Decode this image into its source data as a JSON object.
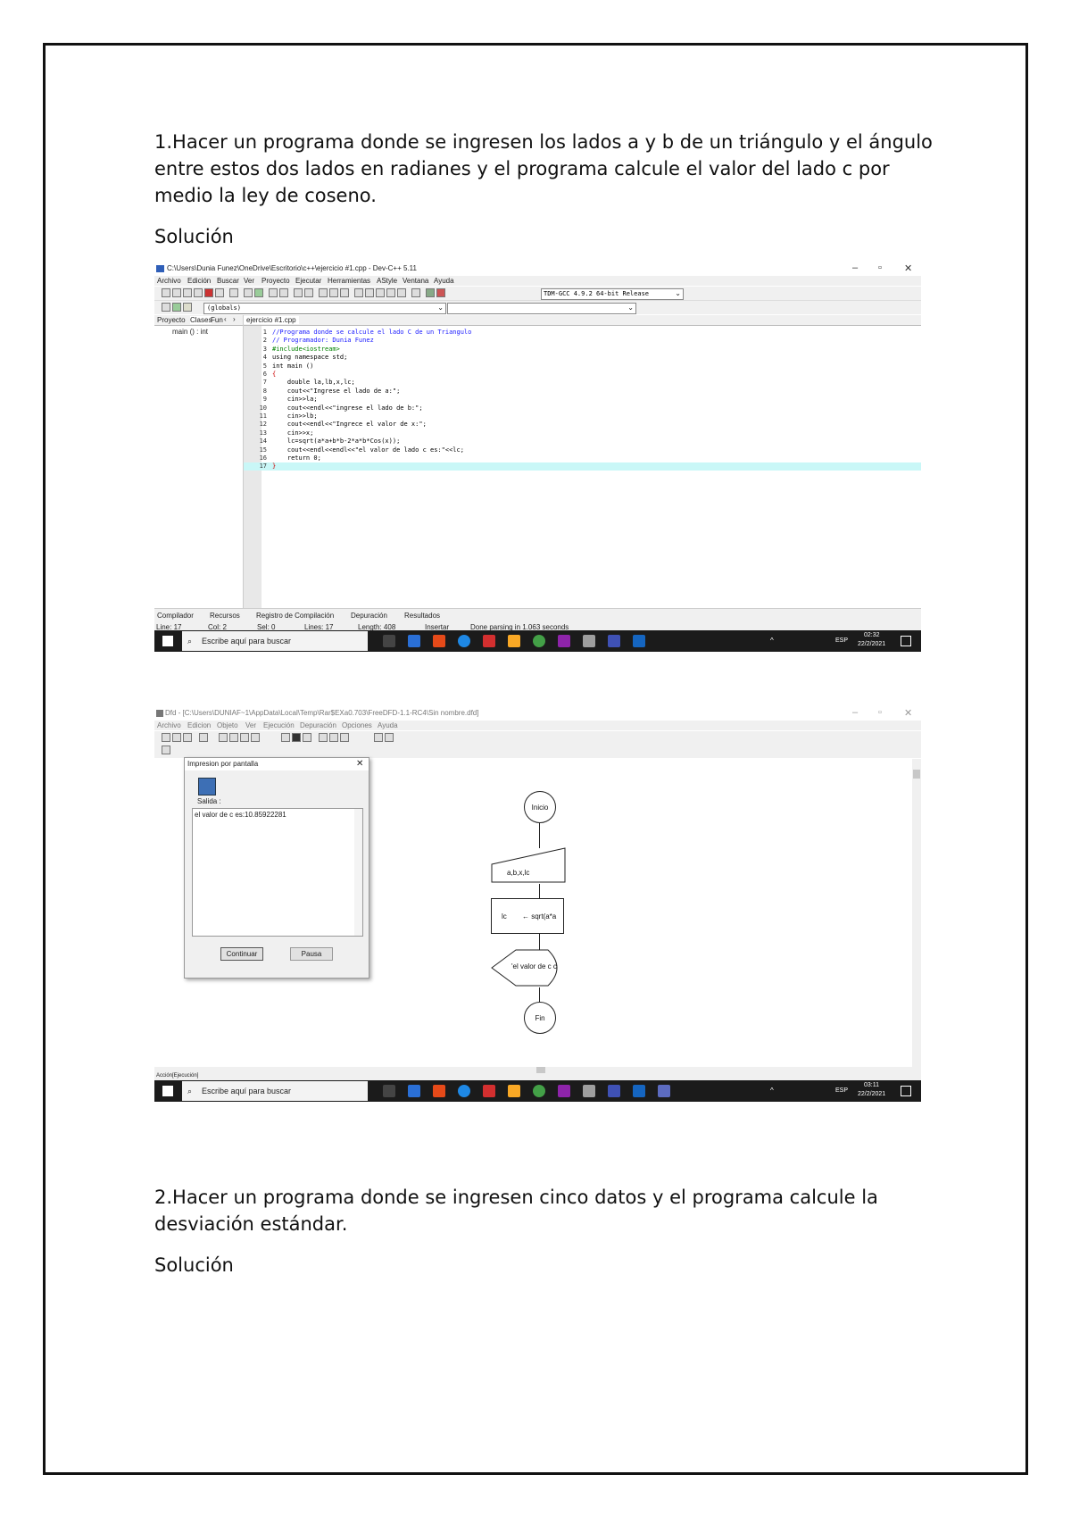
{
  "document": {
    "q1_text": "1.Hacer un programa donde se ingresen los lados a y b de un triángulo y el ángulo entre estos dos lados en radianes y el programa calcule el valor del lado c por medio la ley de coseno.",
    "solucion_label": "Solución",
    "q2_text": " 2.Hacer un programa donde se ingresen cinco datos y el programa calcule la desviación estándar.",
    "solucion2_label": "Solución"
  },
  "devcpp": {
    "title": "C:\\Users\\Dunia Funez\\OneDrive\\Escritorio\\c++\\ejercicio #1.cpp - Dev-C++ 5.11",
    "menu": [
      "Archivo",
      "Edición",
      "Buscar",
      "Ver",
      "Proyecto",
      "Ejecutar",
      "Herramientas",
      "AStyle",
      "Ventana",
      "Ayuda"
    ],
    "compiler_select": "TDM-GCC 4.9.2 64-bit Release",
    "scope_select": "(globals)",
    "left_tabs": [
      "Proyecto",
      "Clases",
      "Fun"
    ],
    "tree_item": "main () : int",
    "file_tab": "ejercicio #1.cpp",
    "code": [
      {
        "n": "1",
        "text": "//Programa donde se calcule el lado C de un Triangulo",
        "color": "#1a1aff"
      },
      {
        "n": "2",
        "text": "// Programador: Dunia Funez",
        "color": "#1a1aff"
      },
      {
        "n": "3",
        "text": "#include<iostream>",
        "color": "#008000"
      },
      {
        "n": "4",
        "text": "using namespace std;",
        "color": "#000000"
      },
      {
        "n": "5",
        "text": "int main ()",
        "color": "#000000"
      },
      {
        "n": "6",
        "text": "{",
        "color": "#cc0000"
      },
      {
        "n": "7",
        "text": "    double la,lb,x,lc;",
        "color": "#000000"
      },
      {
        "n": "8",
        "text": "    cout<<\"Ingrese el lado de a:\";",
        "color": "#000000"
      },
      {
        "n": "9",
        "text": "    cin>>la;",
        "color": "#000000"
      },
      {
        "n": "10",
        "text": "    cout<<endl<<\"ingrese el lado de b:\";",
        "color": "#000000"
      },
      {
        "n": "11",
        "text": "    cin>>lb;",
        "color": "#000000"
      },
      {
        "n": "12",
        "text": "    cout<<endl<<\"Ingrece el valor de x:\";",
        "color": "#000000"
      },
      {
        "n": "13",
        "text": "    cin>>x;",
        "color": "#000000"
      },
      {
        "n": "14",
        "text": "    lc=sqrt(a*a+b*b-2*a*b*Cos(x));",
        "color": "#000000"
      },
      {
        "n": "15",
        "text": "    cout<<endl<<endl<<\"el valor de lado c es:\"<<lc;",
        "color": "#000000"
      },
      {
        "n": "16",
        "text": "    return 0;",
        "color": "#000000"
      },
      {
        "n": "17",
        "text": "}",
        "color": "#cc0000"
      }
    ],
    "bottom_tabs": [
      "Compilador",
      "Recursos",
      "Registro de Compilación",
      "Depuración",
      "Resultados"
    ],
    "status": {
      "line": "Line:   17",
      "col": "Col:   2",
      "sel": "Sel:   0",
      "lines": "Lines:   17",
      "length": "Length:  408",
      "mode": "Insertar",
      "message": "Done parsing in 1.063 seconds"
    },
    "taskbar": {
      "search": "Escribe aquí para buscar",
      "lang": "ESP",
      "time": "02:32",
      "date": "22/2/2021"
    }
  },
  "dfd": {
    "title": "Dfd - [C:\\Users\\DUNIAF~1\\AppData\\Local\\Temp\\Rar$EXa0.703\\FreeDFD-1.1-RC4\\Sin nombre.dfd]",
    "menu": [
      "Archivo",
      "Edicion",
      "Objeto",
      "Ver",
      "Ejecución",
      "Depuración",
      "Opciones",
      "Ayuda"
    ],
    "dialog": {
      "title": "Impresion por pantalla",
      "label": "Salida :",
      "output": "el valor de c es:10.85922281",
      "continue_btn": "Continuar",
      "pause_btn": "Pausa"
    },
    "flow": {
      "start": "Inicio",
      "read": "a,b,x,lc",
      "assign_var": "lc",
      "assign_expr": "sqrt(a*a",
      "output": "'el valor de c c",
      "end": "Fin"
    },
    "statusbar": "Acción[Ejecución]",
    "taskbar": {
      "search": "Escribe aquí para buscar",
      "lang": "ESP",
      "time": "03:11",
      "date": "22/2/2021"
    }
  }
}
